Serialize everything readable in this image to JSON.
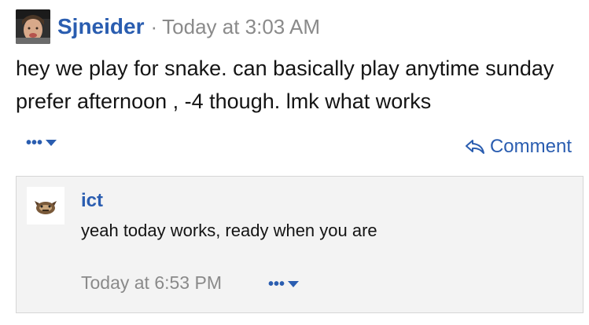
{
  "post": {
    "author": "Sjneider",
    "separator": "·",
    "timestamp": "Today at 3:03 AM",
    "body": "hey we play for snake. can basically play anytime sunday prefer afternoon , -4 though. lmk what works",
    "more_label": "•••",
    "comment_label": "Comment"
  },
  "reply": {
    "author": "ict",
    "body": "yeah today works, ready when you are",
    "timestamp": "Today at 6:53 PM",
    "more_label": "•••"
  },
  "colors": {
    "link": "#2a5db0",
    "muted": "#8a8a8a",
    "reply_bg": "#f3f3f3",
    "reply_border": "#d6d6d6"
  },
  "icons": {
    "more": "ellipsis-caret-icon",
    "comment": "reply-arrow-icon"
  }
}
